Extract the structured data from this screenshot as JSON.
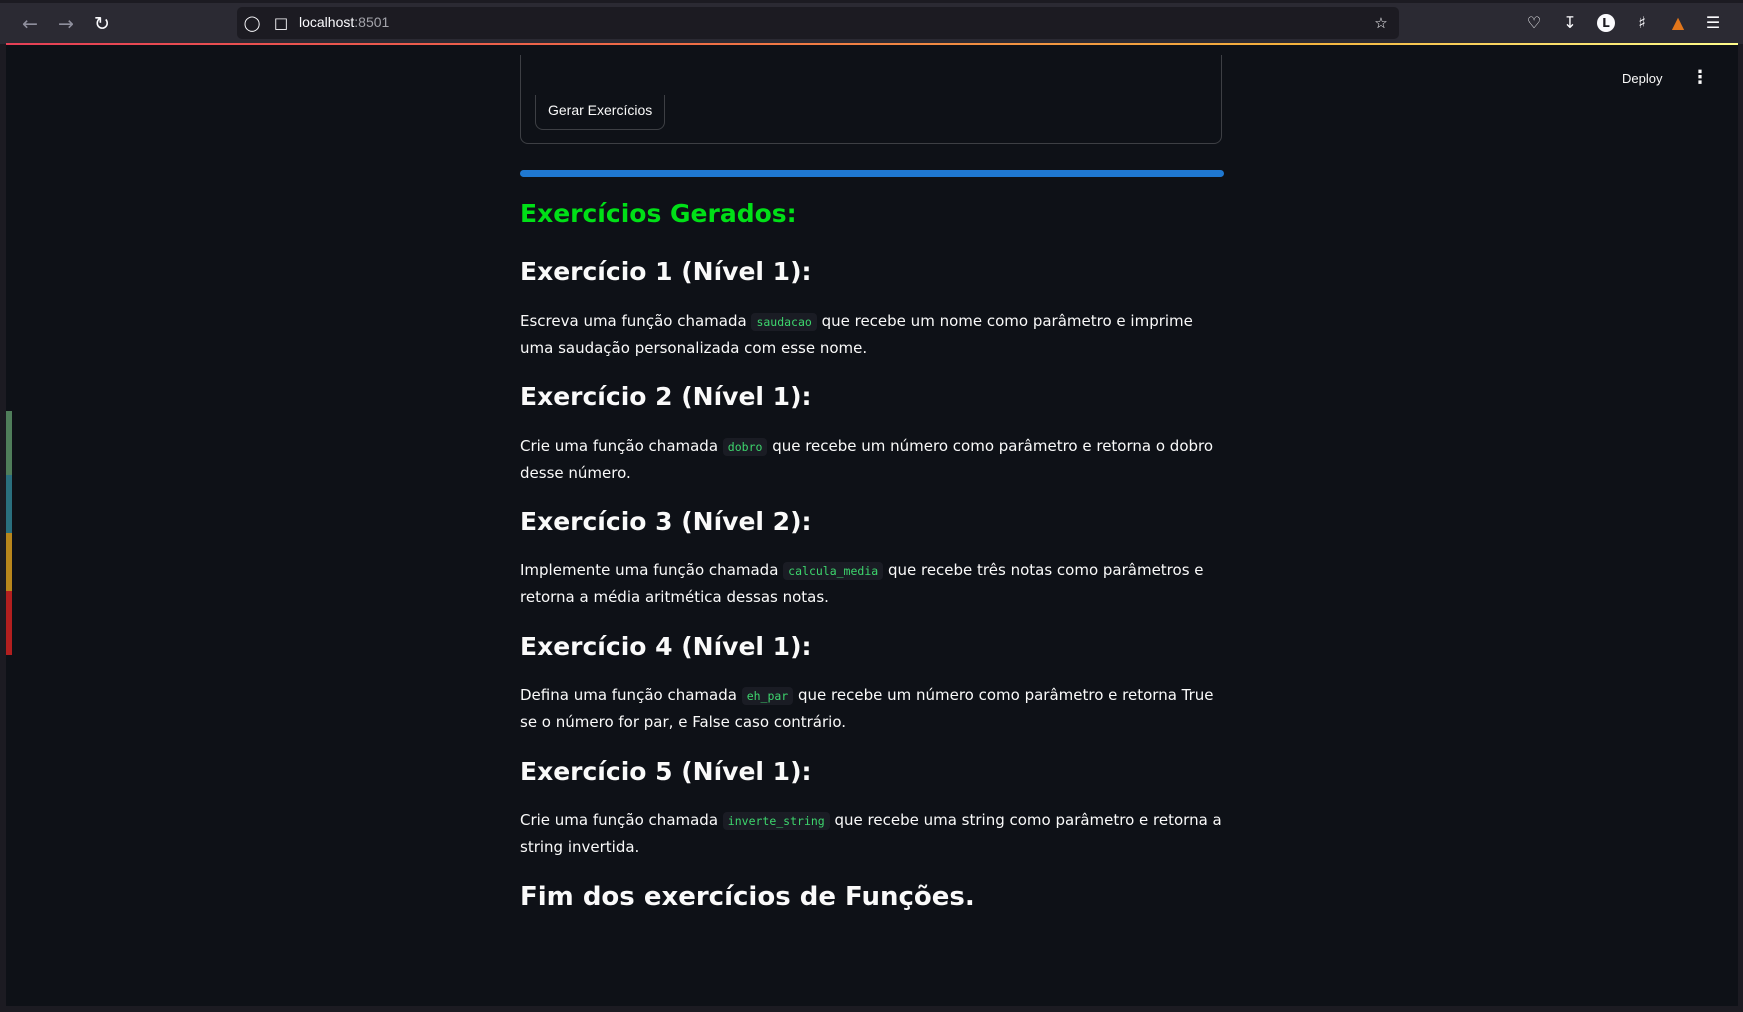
{
  "browser": {
    "url_host": "localhost",
    "url_port": ":8501"
  },
  "header": {
    "deploy_label": "Deploy"
  },
  "form": {
    "button_label": "Gerar Exercícios"
  },
  "main": {
    "title": "Exercícios Gerados:",
    "exercises": [
      {
        "heading": "Exercício 1 (Nível 1):",
        "before": "Escreva uma função chamada ",
        "code": "saudacao",
        "after": " que recebe um nome como parâmetro e imprime uma saudação personalizada com esse nome."
      },
      {
        "heading": "Exercício 2 (Nível 1):",
        "before": "Crie uma função chamada ",
        "code": "dobro",
        "after": " que recebe um número como parâmetro e retorna o dobro desse número."
      },
      {
        "heading": "Exercício 3 (Nível 2):",
        "before": "Implemente uma função chamada ",
        "code": "calcula_media",
        "after": " que recebe três notas como parâmetros e retorna a média aritmética dessas notas."
      },
      {
        "heading": "Exercício 4 (Nível 1):",
        "before": "Defina uma função chamada ",
        "code": "eh_par",
        "after": " que recebe um número como parâmetro e retorna True se o número for par, e False caso contrário."
      },
      {
        "heading": "Exercício 5 (Nível 1):",
        "before": "Crie uma função chamada ",
        "code": "inverte_string",
        "after": " que recebe uma string como parâmetro e retorna a string invertida."
      }
    ],
    "footer": "Fim dos exercícios de Funções."
  },
  "colors": {
    "accent_green": "#00e017",
    "code_green": "#3dd56d",
    "progress_blue": "#1f78d1",
    "app_bg": "#0e1117"
  }
}
